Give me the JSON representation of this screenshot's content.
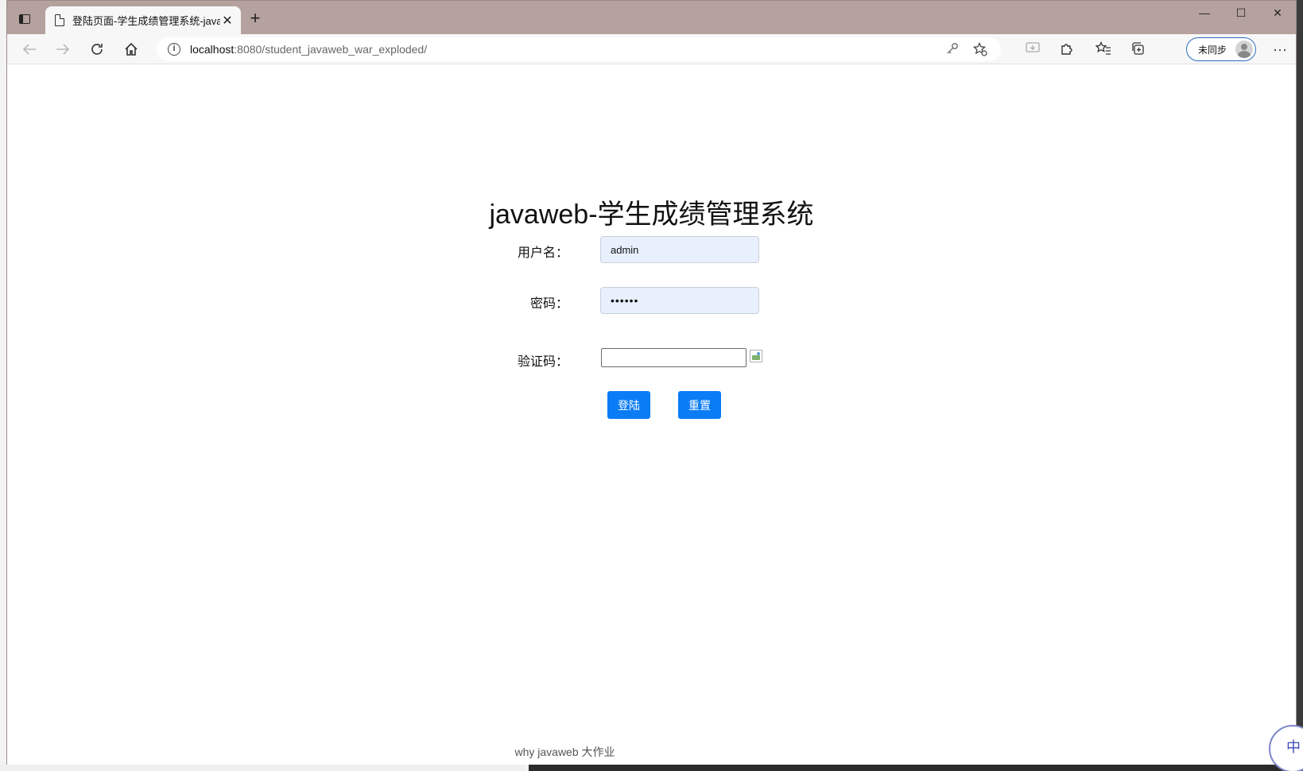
{
  "browser": {
    "tab": {
      "title": "登陆页面-学生成绩管理系统-java",
      "close_glyph": "✕"
    },
    "new_tab_glyph": "+",
    "window_controls": {
      "minimize": "—",
      "maximize": "☐",
      "close": "✕"
    },
    "address": {
      "host": "localhost",
      "path": ":8080/student_javaweb_war_exploded/"
    },
    "profile_label": "未同步",
    "more_glyph": "···"
  },
  "page": {
    "title": "javaweb-学生成绩管理系统",
    "username": {
      "label": "用户名：",
      "value": "admin"
    },
    "password": {
      "label": "密码：",
      "value": "••••••"
    },
    "captcha": {
      "label": "验证码：",
      "value": ""
    },
    "login_button": "登陆",
    "reset_button": "重置",
    "footer": "why javaweb 大作业"
  },
  "ime": {
    "label": "中"
  },
  "colors": {
    "tabbar": "#b5a19e",
    "button": "#0a7cf5",
    "autofill": "#e8f0fe"
  }
}
